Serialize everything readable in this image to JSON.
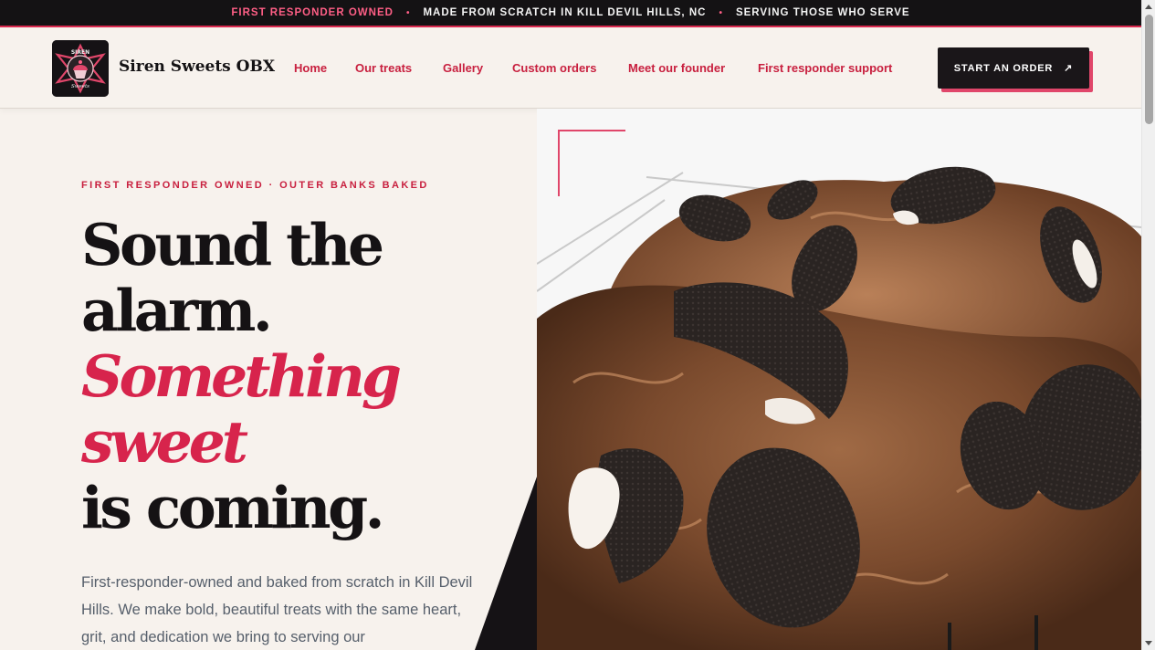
{
  "topbar": {
    "item1": "FIRST RESPONDER OWNED",
    "item2": "MADE FROM SCRATCH IN KILL DEVIL HILLS, NC",
    "item3": "SERVING THOSE WHO SERVE",
    "separator": "•"
  },
  "header": {
    "brand": "Siren Sweets OBX",
    "logo_icon": "siren-cupcake-badge-icon",
    "nav": [
      "Home",
      "Our treats",
      "Gallery",
      "Custom orders",
      "Meet our founder",
      "First responder support"
    ],
    "cta_label": "START AN ORDER",
    "cta_icon": "↗"
  },
  "hero": {
    "eyebrow": "FIRST RESPONDER OWNED · OUTER BANKS BAKED",
    "headline_1": "Sound the",
    "headline_2": "alarm.",
    "headline_accent_1": "Something",
    "headline_accent_2": "sweet",
    "headline_3": "is coming.",
    "body": "First-responder-owned and baked from scratch in Kill Devil Hills. We make bold, beautiful treats with the same heart, grit, and dedication we bring to serving our",
    "image_icon": "cookies-and-cream-brownie-photo"
  },
  "colors": {
    "accent": "#d7244c",
    "dark": "#141214",
    "background": "#f7f2ed"
  }
}
